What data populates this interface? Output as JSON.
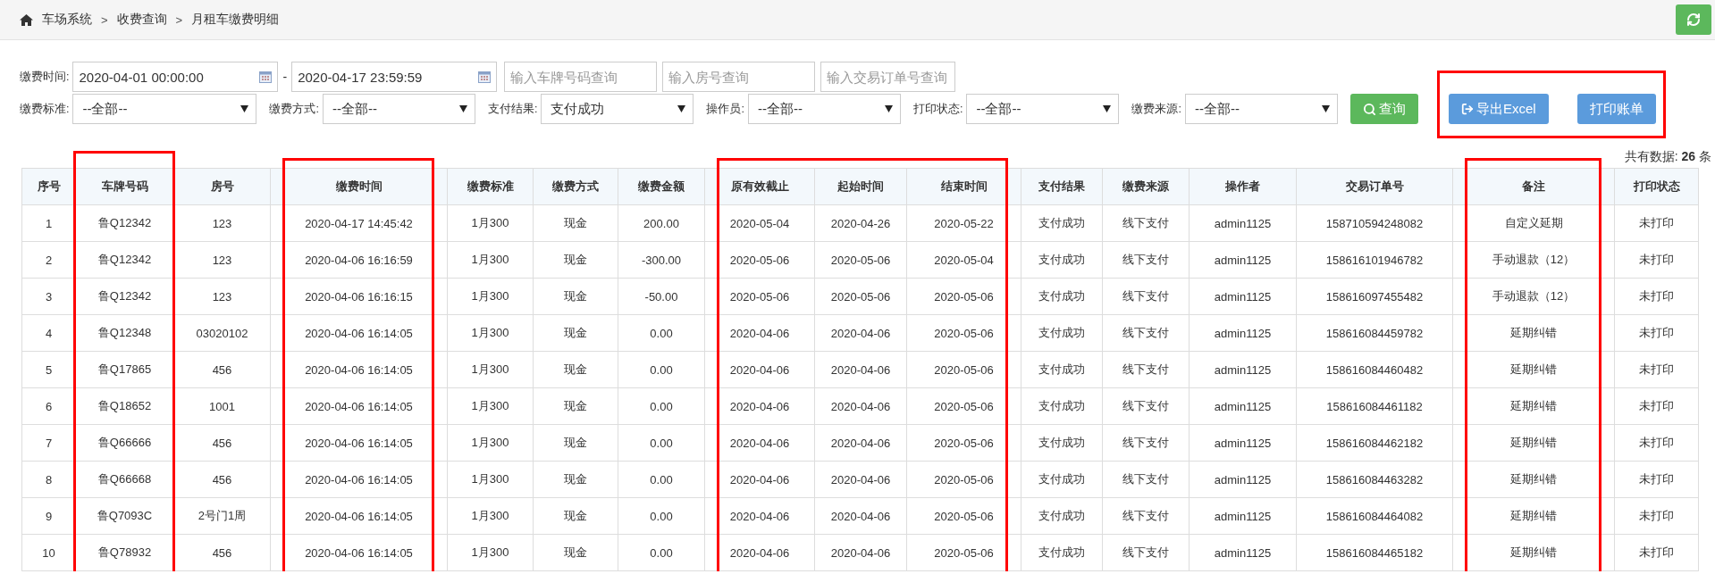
{
  "breadcrumb": [
    {
      "kind": "link",
      "label": "车场系统"
    },
    {
      "kind": "sep",
      "label": ">"
    },
    {
      "kind": "link",
      "label": "收费查询"
    },
    {
      "kind": "sep",
      "label": ">"
    },
    {
      "kind": "current",
      "label": "月租车缴费明细"
    }
  ],
  "date_range": {
    "label": "缴费时间:",
    "start": "2020-04-01 00:00:00",
    "separator": "-",
    "end": "2020-04-17 23:59:59"
  },
  "search_fields": [
    {
      "placeholder": "输入车牌号码查询"
    },
    {
      "placeholder": "输入房号查询"
    },
    {
      "placeholder": "输入交易订单号查询"
    }
  ],
  "selects": [
    {
      "label": "缴费标准:",
      "value": "--全部--"
    },
    {
      "label": "缴费方式:",
      "value": "--全部--"
    },
    {
      "label": "支付结果:",
      "value": "支付成功"
    },
    {
      "label": "操作员:",
      "value": "--全部--"
    },
    {
      "label": "打印状态:",
      "value": "--全部--"
    },
    {
      "label": "缴费来源:",
      "value": "--全部--"
    }
  ],
  "search_button": {
    "label": "查询"
  },
  "action_group": {
    "highlighted": true,
    "buttons": [
      {
        "kind": "export",
        "label": "导出Excel"
      },
      {
        "kind": "print",
        "label": "打印账单"
      }
    ]
  },
  "total": {
    "prefix": "共有数据:",
    "value": "26",
    "suffix": "条"
  },
  "table": {
    "columns": [
      {
        "label": "序号",
        "highlighted": false
      },
      {
        "label": "车牌号码",
        "highlighted": true
      },
      {
        "label": "房号",
        "highlighted": false
      },
      {
        "label": "缴费时间",
        "highlighted": true
      },
      {
        "label": "缴费标准",
        "highlighted": false
      },
      {
        "label": "缴费方式",
        "highlighted": false
      },
      {
        "label": "缴费金额",
        "highlighted": false
      },
      {
        "label": "原有效截止",
        "highlighted": true
      },
      {
        "label": "起始时间",
        "highlighted": true
      },
      {
        "label": "结束时间",
        "highlighted": true
      },
      {
        "label": "支付结果",
        "highlighted": false
      },
      {
        "label": "缴费来源",
        "highlighted": false
      },
      {
        "label": "操作者",
        "highlighted": false
      },
      {
        "label": "交易订单号",
        "highlighted": false
      },
      {
        "label": "备注",
        "highlighted": true
      },
      {
        "label": "打印状态",
        "highlighted": false
      }
    ],
    "rows": [
      [
        "1",
        "鲁Q12342",
        "123",
        "2020-04-17 14:45:42",
        "1月300",
        "现金",
        "200.00",
        "2020-05-04",
        "2020-04-26",
        "2020-05-22",
        "支付成功",
        "线下支付",
        "admin1125",
        "158710594248082",
        "自定义延期",
        "未打印"
      ],
      [
        "2",
        "鲁Q12342",
        "123",
        "2020-04-06 16:16:59",
        "1月300",
        "现金",
        "-300.00",
        "2020-05-06",
        "2020-05-06",
        "2020-05-04",
        "支付成功",
        "线下支付",
        "admin1125",
        "158616101946782",
        "手动退款（12）",
        "未打印"
      ],
      [
        "3",
        "鲁Q12342",
        "123",
        "2020-04-06 16:16:15",
        "1月300",
        "现金",
        "-50.00",
        "2020-05-06",
        "2020-05-06",
        "2020-05-06",
        "支付成功",
        "线下支付",
        "admin1125",
        "158616097455482",
        "手动退款（12）",
        "未打印"
      ],
      [
        "4",
        "鲁Q12348",
        "03020102",
        "2020-04-06 16:14:05",
        "1月300",
        "现金",
        "0.00",
        "2020-04-06",
        "2020-04-06",
        "2020-05-06",
        "支付成功",
        "线下支付",
        "admin1125",
        "158616084459782",
        "延期纠错",
        "未打印"
      ],
      [
        "5",
        "鲁Q17865",
        "456",
        "2020-04-06 16:14:05",
        "1月300",
        "现金",
        "0.00",
        "2020-04-06",
        "2020-04-06",
        "2020-05-06",
        "支付成功",
        "线下支付",
        "admin1125",
        "158616084460482",
        "延期纠错",
        "未打印"
      ],
      [
        "6",
        "鲁Q18652",
        "1001",
        "2020-04-06 16:14:05",
        "1月300",
        "现金",
        "0.00",
        "2020-04-06",
        "2020-04-06",
        "2020-05-06",
        "支付成功",
        "线下支付",
        "admin1125",
        "158616084461182",
        "延期纠错",
        "未打印"
      ],
      [
        "7",
        "鲁Q66666",
        "456",
        "2020-04-06 16:14:05",
        "1月300",
        "现金",
        "0.00",
        "2020-04-06",
        "2020-04-06",
        "2020-05-06",
        "支付成功",
        "线下支付",
        "admin1125",
        "158616084462182",
        "延期纠错",
        "未打印"
      ],
      [
        "8",
        "鲁Q66668",
        "456",
        "2020-04-06 16:14:05",
        "1月300",
        "现金",
        "0.00",
        "2020-04-06",
        "2020-04-06",
        "2020-05-06",
        "支付成功",
        "线下支付",
        "admin1125",
        "158616084463282",
        "延期纠错",
        "未打印"
      ],
      [
        "9",
        "鲁Q7093C",
        "2号门1周",
        "2020-04-06 16:14:05",
        "1月300",
        "现金",
        "0.00",
        "2020-04-06",
        "2020-04-06",
        "2020-05-06",
        "支付成功",
        "线下支付",
        "admin1125",
        "158616084464082",
        "延期纠错",
        "未打印"
      ],
      [
        "10",
        "鲁Q78932",
        "456",
        "2020-04-06 16:14:05",
        "1月300",
        "现金",
        "0.00",
        "2020-04-06",
        "2020-04-06",
        "2020-05-06",
        "支付成功",
        "线下支付",
        "admin1125",
        "158616084465182",
        "延期纠错",
        "未打印"
      ]
    ]
  }
}
